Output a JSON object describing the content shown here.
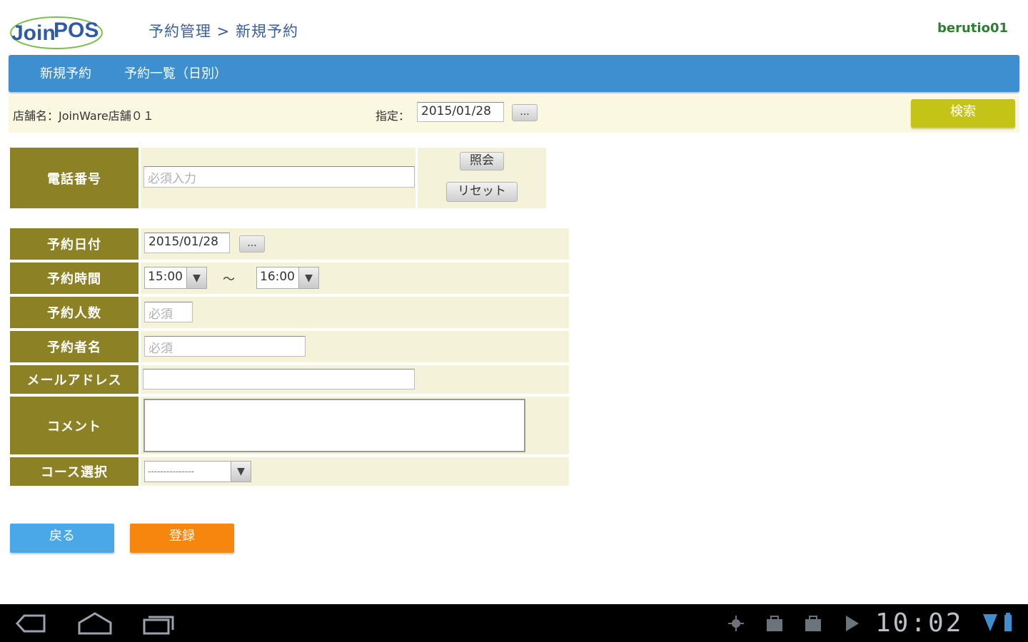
{
  "header": {
    "logo_text_join": "Join",
    "logo_text_pos": "POS",
    "breadcrumb": "予約管理 > 新規予約",
    "username": "berutio01"
  },
  "nav": {
    "items": [
      {
        "label": "新規予約"
      },
      {
        "label": "予約一覧（日別）"
      }
    ]
  },
  "filter": {
    "shop_name": "店舗名：JoinWare店舗０１",
    "date_label": "指定：",
    "date_value": "2015/01/28",
    "picker_label": "...",
    "search_label": "検索"
  },
  "phone": {
    "label": "電話番号",
    "placeholder": "必須入力",
    "lookup_label": "照会",
    "reset_label": "リセット"
  },
  "form": {
    "date_label": "予約日付",
    "date_value": "2015/01/28",
    "date_picker_label": "...",
    "time_label": "予約時間",
    "time_start": "15:00",
    "time_separator": "～",
    "time_end": "16:00",
    "people_label": "予約人数",
    "people_placeholder": "必須",
    "name_label": "予約者名",
    "name_placeholder": "必須",
    "email_label": "メールアドレス",
    "email_value": "",
    "comment_label": "コメント",
    "comment_value": "",
    "course_label": "コース選択",
    "course_value": "---------------"
  },
  "actions": {
    "back_label": "戻る",
    "register_label": "登録"
  },
  "system": {
    "clock": "10:02"
  },
  "colors": {
    "nav_bg": "#3d8fcf",
    "label_bg": "#8c8124",
    "value_bg": "#f4f2d8",
    "search_bg": "#c4c317",
    "back_bg": "#4aa8e8",
    "register_bg": "#f7860f"
  }
}
